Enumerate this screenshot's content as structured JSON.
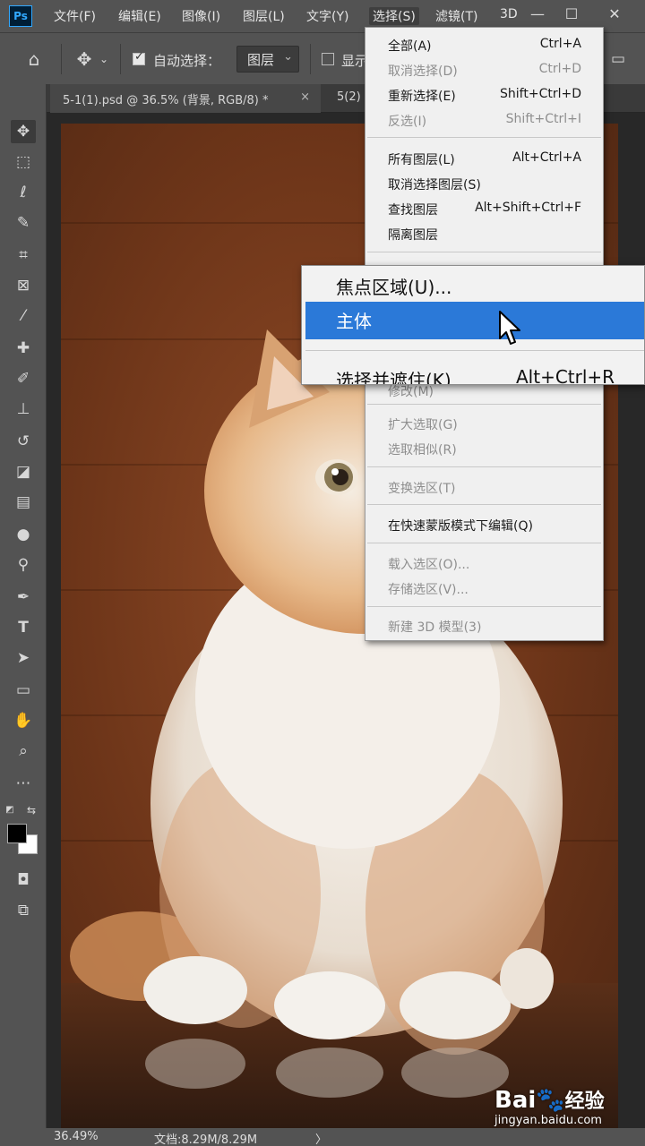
{
  "app": {
    "logo": "Ps"
  },
  "menubar": {
    "items": [
      "文件(F)",
      "编辑(E)",
      "图像(I)",
      "图层(L)",
      "文字(Y)",
      "选择(S)",
      "滤镜(T)",
      "3D"
    ],
    "active": "选择(S)"
  },
  "options": {
    "auto_select_label": "自动选择：",
    "auto_select_target": "图层",
    "show_transform_partial": "显示"
  },
  "tabs": [
    {
      "label": "5-1(1).psd @ 36.5% (背景, RGB/8) *",
      "close": "×"
    },
    {
      "label": "5(2)"
    }
  ],
  "select_menu": {
    "items": [
      {
        "label": "全部(A)",
        "shortcut": "Ctrl+A",
        "enabled": true
      },
      {
        "label": "取消选择(D)",
        "shortcut": "Ctrl+D",
        "enabled": false
      },
      {
        "label": "重新选择(E)",
        "shortcut": "Shift+Ctrl+D",
        "enabled": true
      },
      {
        "label": "反选(I)",
        "shortcut": "Shift+Ctrl+I",
        "enabled": false
      },
      {
        "label": "所有图层(L)",
        "shortcut": "Alt+Ctrl+A",
        "enabled": true
      },
      {
        "label": "取消选择图层(S)",
        "shortcut": "",
        "enabled": true
      },
      {
        "label": "查找图层",
        "shortcut": "Alt+Shift+Ctrl+F",
        "enabled": true
      },
      {
        "label": "隔离图层",
        "shortcut": "",
        "enabled": true
      },
      {
        "label": "修改(M)",
        "shortcut": "",
        "enabled": false
      },
      {
        "label": "扩大选取(G)",
        "shortcut": "",
        "enabled": false
      },
      {
        "label": "选取相似(R)",
        "shortcut": "",
        "enabled": false
      },
      {
        "label": "变换选区(T)",
        "shortcut": "",
        "enabled": false
      },
      {
        "label": "在快速蒙版模式下编辑(Q)",
        "shortcut": "",
        "enabled": true
      },
      {
        "label": "载入选区(O)...",
        "shortcut": "",
        "enabled": false
      },
      {
        "label": "存储选区(V)...",
        "shortcut": "",
        "enabled": false
      },
      {
        "label": "新建 3D 模型(3)",
        "shortcut": "",
        "enabled": false
      }
    ]
  },
  "submenu": {
    "items": [
      {
        "label": "焦点区域(U)...",
        "shortcut": "",
        "highlighted": false
      },
      {
        "label": "主体",
        "shortcut": "",
        "highlighted": true
      },
      {
        "label": "选择并遮住(K)...",
        "shortcut": "Alt+Ctrl+R",
        "highlighted": false
      }
    ]
  },
  "status": {
    "zoom": "36.49%",
    "doc": "文档:8.29M/8.29M",
    "arrow": "〉"
  },
  "watermark": {
    "brand": "Bai",
    "brand2": "经验",
    "url": "jingyan.baidu.com"
  },
  "colors": {
    "highlight": "#2b79d8",
    "ui_dark": "#535353",
    "menu_bg": "#f0f0f0"
  }
}
